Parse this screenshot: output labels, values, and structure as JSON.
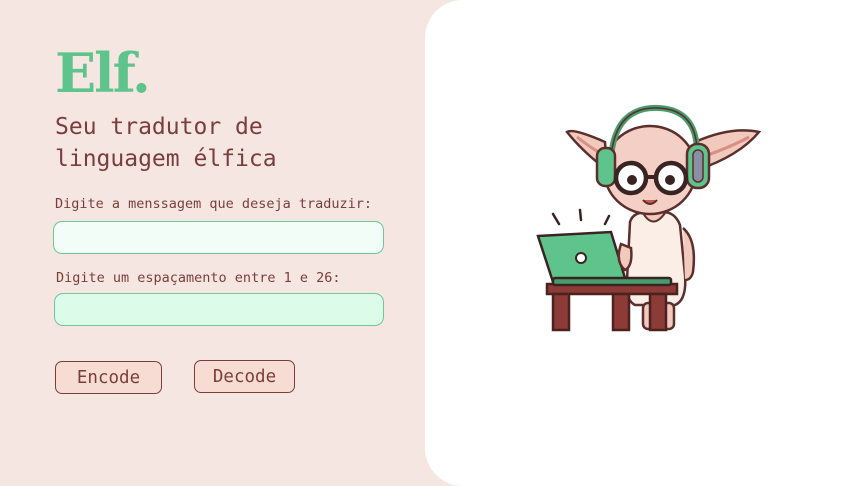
{
  "brand": {
    "logo": "Elf.",
    "subtitle": "Seu tradutor de linguagem élfica"
  },
  "form": {
    "message_label": "Digite a menssagem que deseja traduzir:",
    "message_value": "",
    "shift_label": "Digite um espaçamento entre 1 e 26:",
    "shift_value": ""
  },
  "actions": {
    "encode_label": "Encode",
    "decode_label": "Decode"
  },
  "illustration": {
    "icon": "elf-with-headphones-and-laptop-icon"
  },
  "colors": {
    "background": "#f5e6e1",
    "accent_green": "#5fc48c",
    "text_brown": "#7a3e3a",
    "button_bg": "#f7dcd4",
    "panel": "#ffffff"
  }
}
